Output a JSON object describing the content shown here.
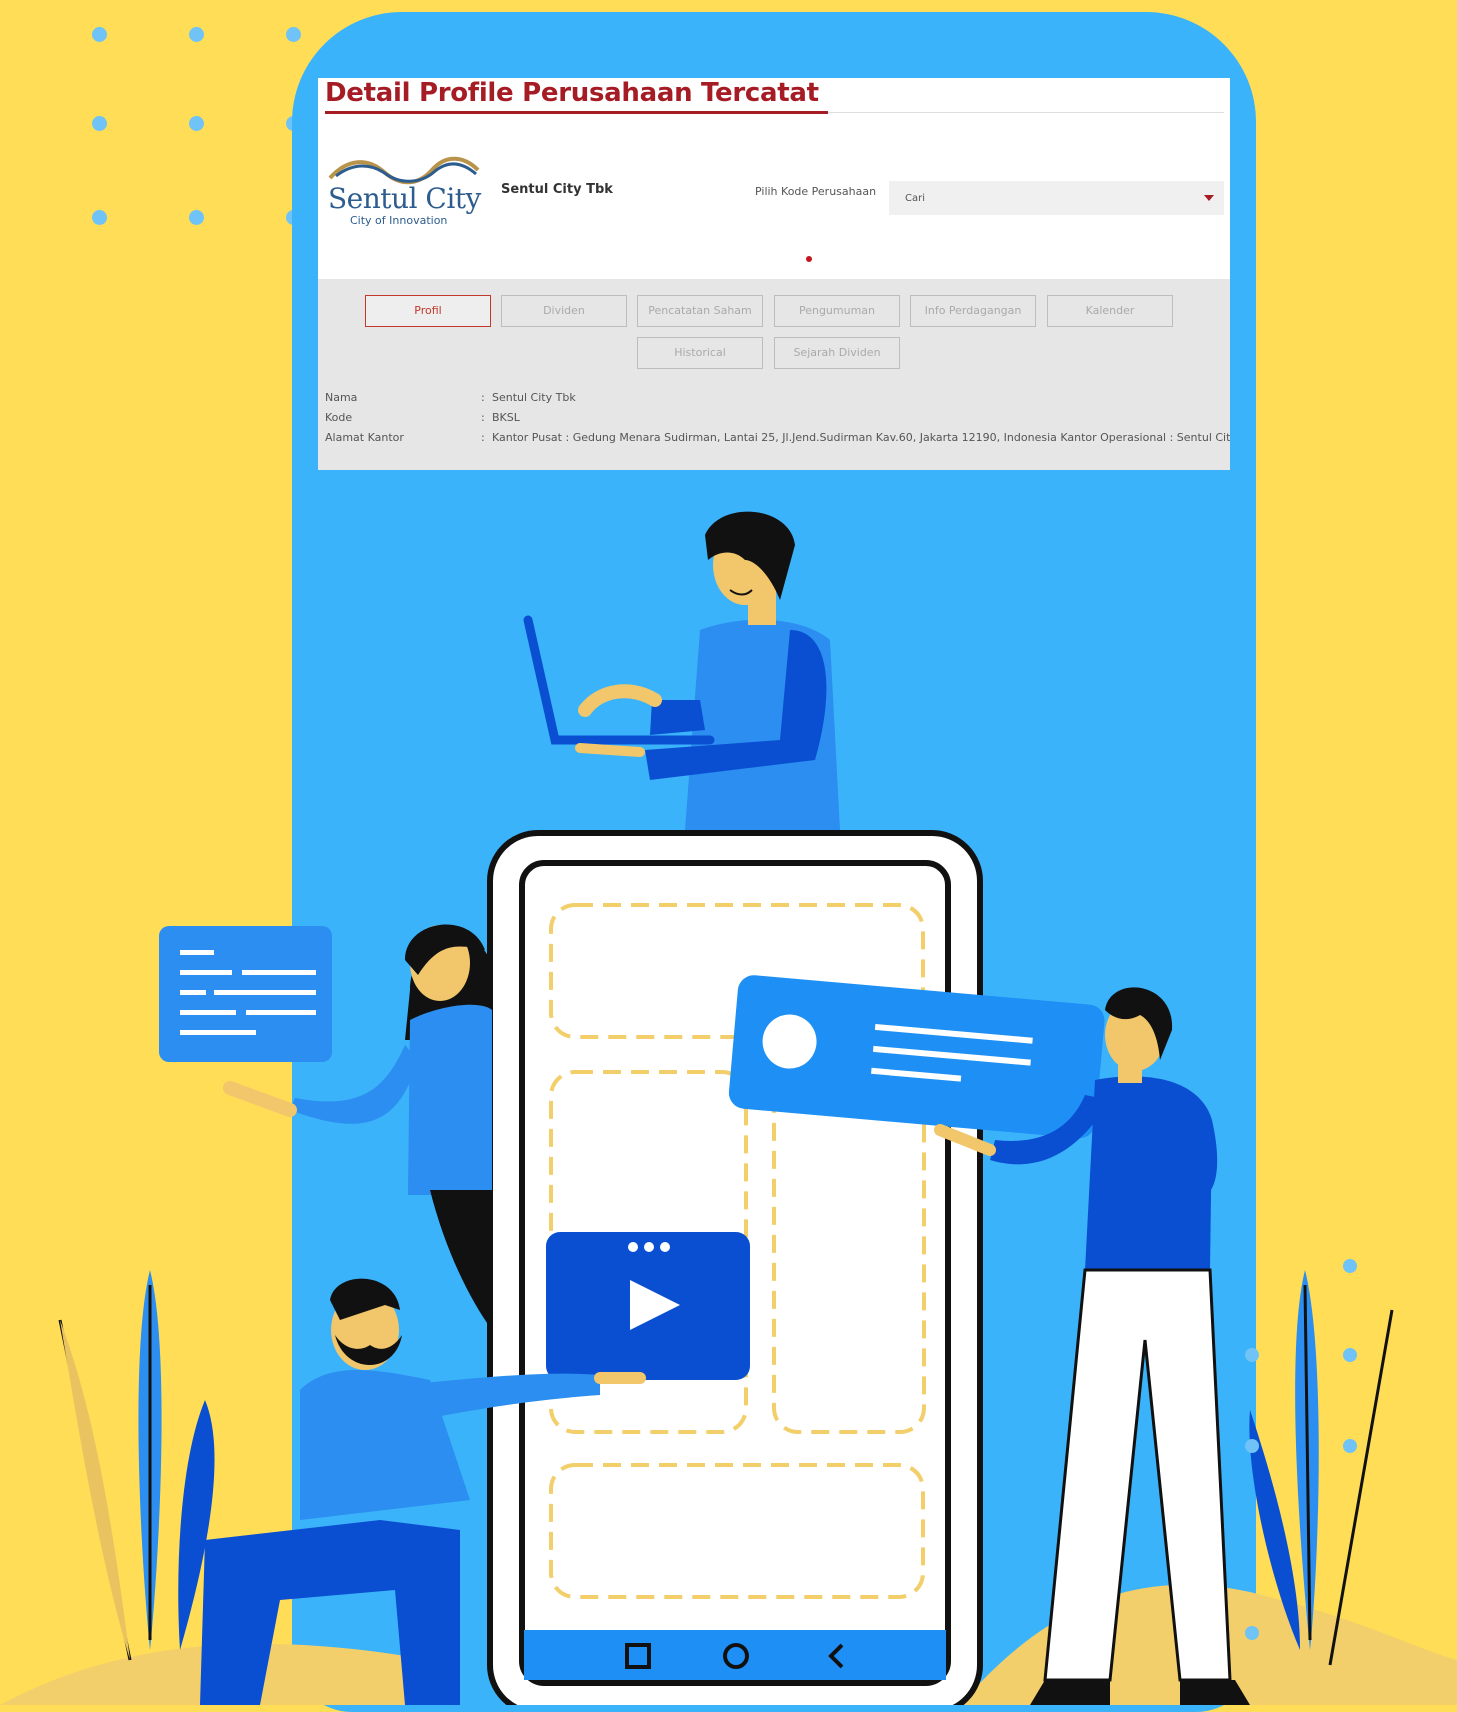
{
  "page": {
    "title": "Detail Profile Perusahaan Tercatat",
    "colors": {
      "background": "#FFDD57",
      "phone": "#3BB3FA",
      "accent": "#A61C25",
      "dark_blue": "#0A4FD1"
    }
  },
  "logo": {
    "wordmark": "Sentul City",
    "tagline": "City of Innovation"
  },
  "company": {
    "name": "Sentul City Tbk"
  },
  "search": {
    "label": "Pilih Kode Perusahaan",
    "selected": "Cari"
  },
  "tabs": [
    {
      "label": "Profil",
      "active": true
    },
    {
      "label": "Dividen"
    },
    {
      "label": "Pencatatan Saham"
    },
    {
      "label": "Pengumuman"
    },
    {
      "label": "Info Perdagangan"
    },
    {
      "label": "Kalender"
    },
    {
      "label": "Historical"
    },
    {
      "label": "Sejarah Dividen"
    }
  ],
  "profile": [
    {
      "label": "Nama",
      "value": "Sentul City Tbk"
    },
    {
      "label": "Kode",
      "value": "BKSL"
    },
    {
      "label": "Alamat Kantor",
      "value": "Kantor Pusat : Gedung Menara Sudirman, Lantai 25, Jl.Jend.Sudirman Kav.60, Jakarta 12190, Indonesia Kantor Operasional : Sentul City"
    }
  ],
  "illustration": {
    "icons": [
      "laptop-icon",
      "chat-card-icon",
      "video-play-icon",
      "profile-card-icon",
      "nav-square-icon",
      "nav-circle-icon",
      "nav-back-icon"
    ]
  }
}
